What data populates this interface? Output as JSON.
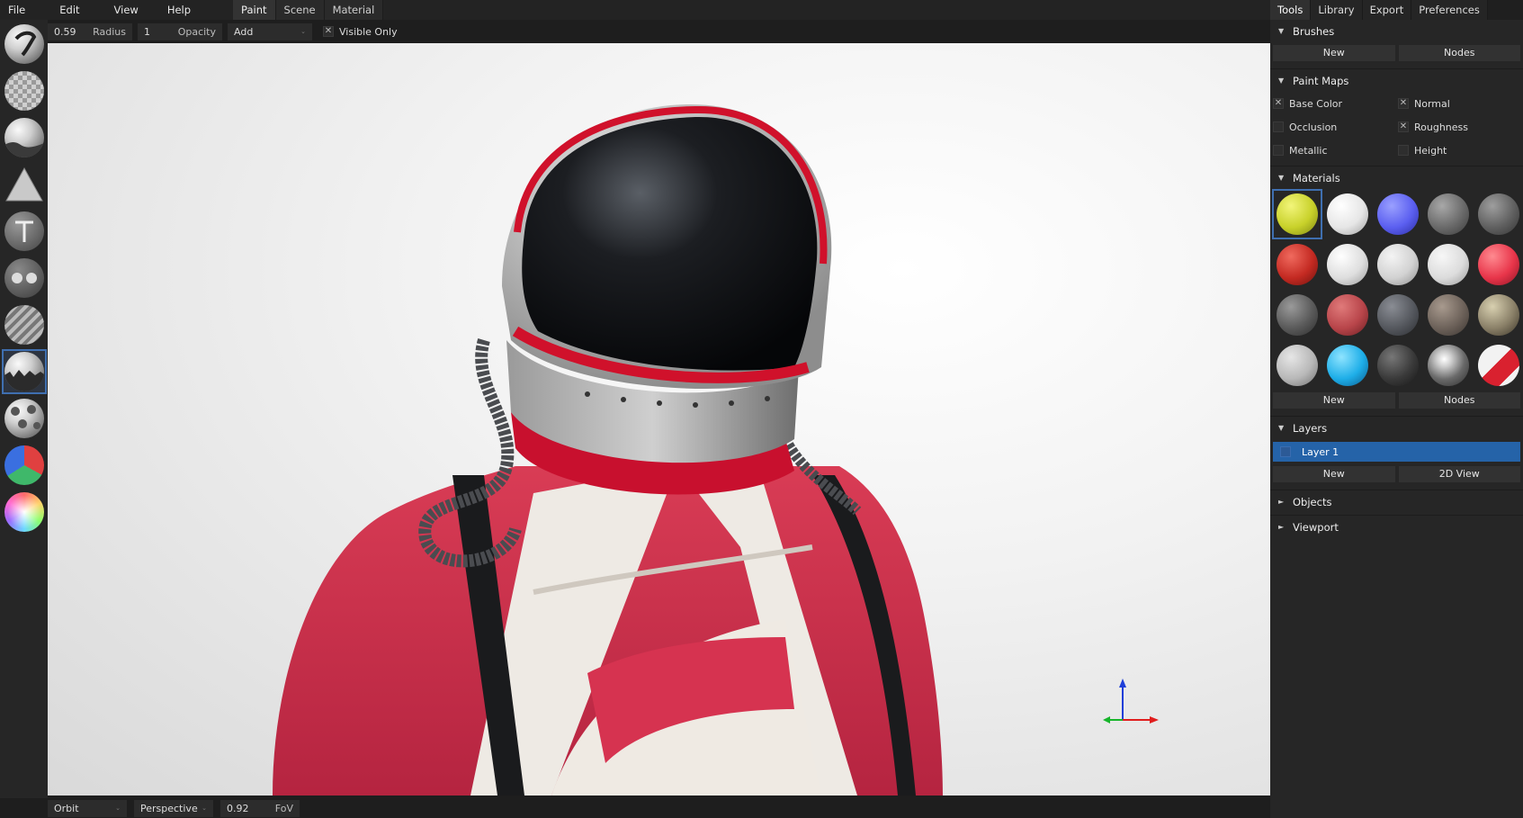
{
  "menu": {
    "items": [
      "File",
      "Edit",
      "View",
      "Help"
    ],
    "workspace_tabs": [
      "Paint",
      "Scene",
      "Material"
    ],
    "active_tab": "Paint"
  },
  "header": {
    "radius_value": "0.59",
    "radius_label": "Radius",
    "opacity_value": "1",
    "opacity_label": "Opacity",
    "blend_mode": "Add",
    "visible_only_label": "Visible Only",
    "visible_only_checked": true
  },
  "toolbar": {
    "tools": [
      "brush",
      "eraser",
      "fill",
      "decal",
      "text",
      "clone",
      "blur",
      "particle",
      "bake",
      "colorid",
      "picker"
    ],
    "active_tool": 7
  },
  "statusbar": {
    "camera_mode": "Orbit",
    "projection": "Perspective",
    "fov_value": "0.92",
    "fov_label": "FoV"
  },
  "right_panel": {
    "tabs": [
      "Tools",
      "Library",
      "Export",
      "Preferences"
    ],
    "active_tab": "Tools",
    "brushes": {
      "title": "Brushes",
      "new_label": "New",
      "nodes_label": "Nodes"
    },
    "paint_maps": {
      "title": "Paint Maps",
      "base_color": {
        "label": "Base Color",
        "checked": true
      },
      "normal": {
        "label": "Normal",
        "checked": true
      },
      "occlusion": {
        "label": "Occlusion",
        "checked": false
      },
      "roughness": {
        "label": "Roughness",
        "checked": true
      },
      "metallic": {
        "label": "Metallic",
        "checked": false
      },
      "height": {
        "label": "Height",
        "checked": false
      }
    },
    "materials": {
      "title": "Materials",
      "selected_index": 0,
      "new_label": "New",
      "nodes_label": "Nodes"
    },
    "layers": {
      "title": "Layers",
      "layer_name": "Layer 1",
      "new_label": "New",
      "view2d_label": "2D View"
    },
    "objects_title": "Objects",
    "viewport_title": "Viewport"
  },
  "icons": {
    "expanded": "▼",
    "collapsed": "►",
    "check": "✕",
    "dropdown": "⌄"
  }
}
